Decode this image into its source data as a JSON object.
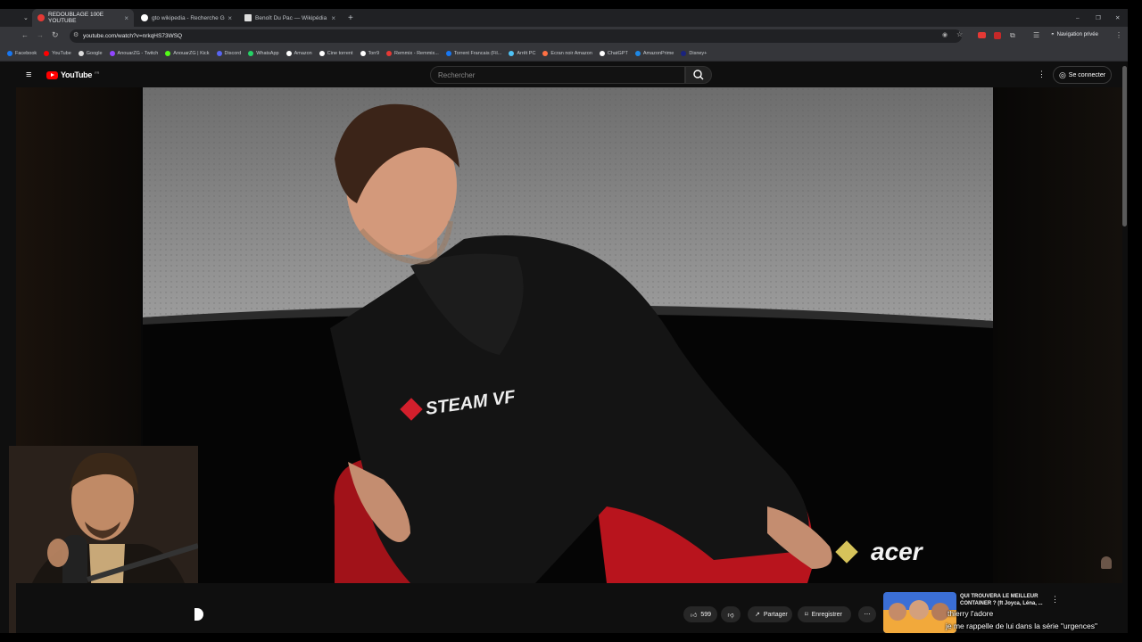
{
  "browser": {
    "tabs": [
      {
        "title": "REDOUBLAGE 100E YOUTUBE",
        "active": true,
        "favicon_color": "#e53935"
      },
      {
        "title": "gto wikipedia - Recherche Goo",
        "active": false,
        "favicon_color": "#ffffff"
      },
      {
        "title": "Benoît Du Pac — Wikipédia",
        "active": false,
        "favicon_color": "#dddddd"
      }
    ],
    "url": "youtube.com/watch?v=nrkqHS73WSQ",
    "private_label": "Navigation privée",
    "bookmarks": [
      {
        "label": "Facebook",
        "color": "#1877f2"
      },
      {
        "label": "YouTube",
        "color": "#ff0000"
      },
      {
        "label": "Google",
        "color": "#dddddd"
      },
      {
        "label": "AnouarZG - Twitch",
        "color": "#9146ff"
      },
      {
        "label": "AnouarZG | Kick",
        "color": "#53fc18"
      },
      {
        "label": "Discord",
        "color": "#5865f2"
      },
      {
        "label": "WhatsApp",
        "color": "#25d366"
      },
      {
        "label": "Amazon",
        "color": "#ffffff"
      },
      {
        "label": "Cine torrent",
        "color": "#ffffff"
      },
      {
        "label": "Torr9",
        "color": "#ffffff"
      },
      {
        "label": "Remmix - Remmix...",
        "color": "#e53935"
      },
      {
        "label": "Torrent Francais (Fil...",
        "color": "#1877f2"
      },
      {
        "label": "Arrêt PC",
        "color": "#4fc3f7"
      },
      {
        "label": "Ecran noir Amazon",
        "color": "#ff7043"
      },
      {
        "label": "ChatGPT",
        "color": "#ffffff"
      },
      {
        "label": "AmazonPrime",
        "color": "#1e88e5"
      },
      {
        "label": "Disney+",
        "color": "#1a237e"
      }
    ]
  },
  "youtube": {
    "logo": "YouTube",
    "region": "FR",
    "search_placeholder": "Rechercher",
    "signin": "Se connecter",
    "likes": "599",
    "share": "Partager",
    "save": "Enregistrer",
    "recommended_title": "QUI TROUVERA LE MEILLEUR CONTAINER ? (ft Joyca, Léna, ...",
    "video_logo": "STEAM VF",
    "sponsor": "acer"
  },
  "overlay": {
    "chat_name": "thierry l'adore",
    "subtitle": "je me rappelle de lui dans la série \"urgences\""
  }
}
